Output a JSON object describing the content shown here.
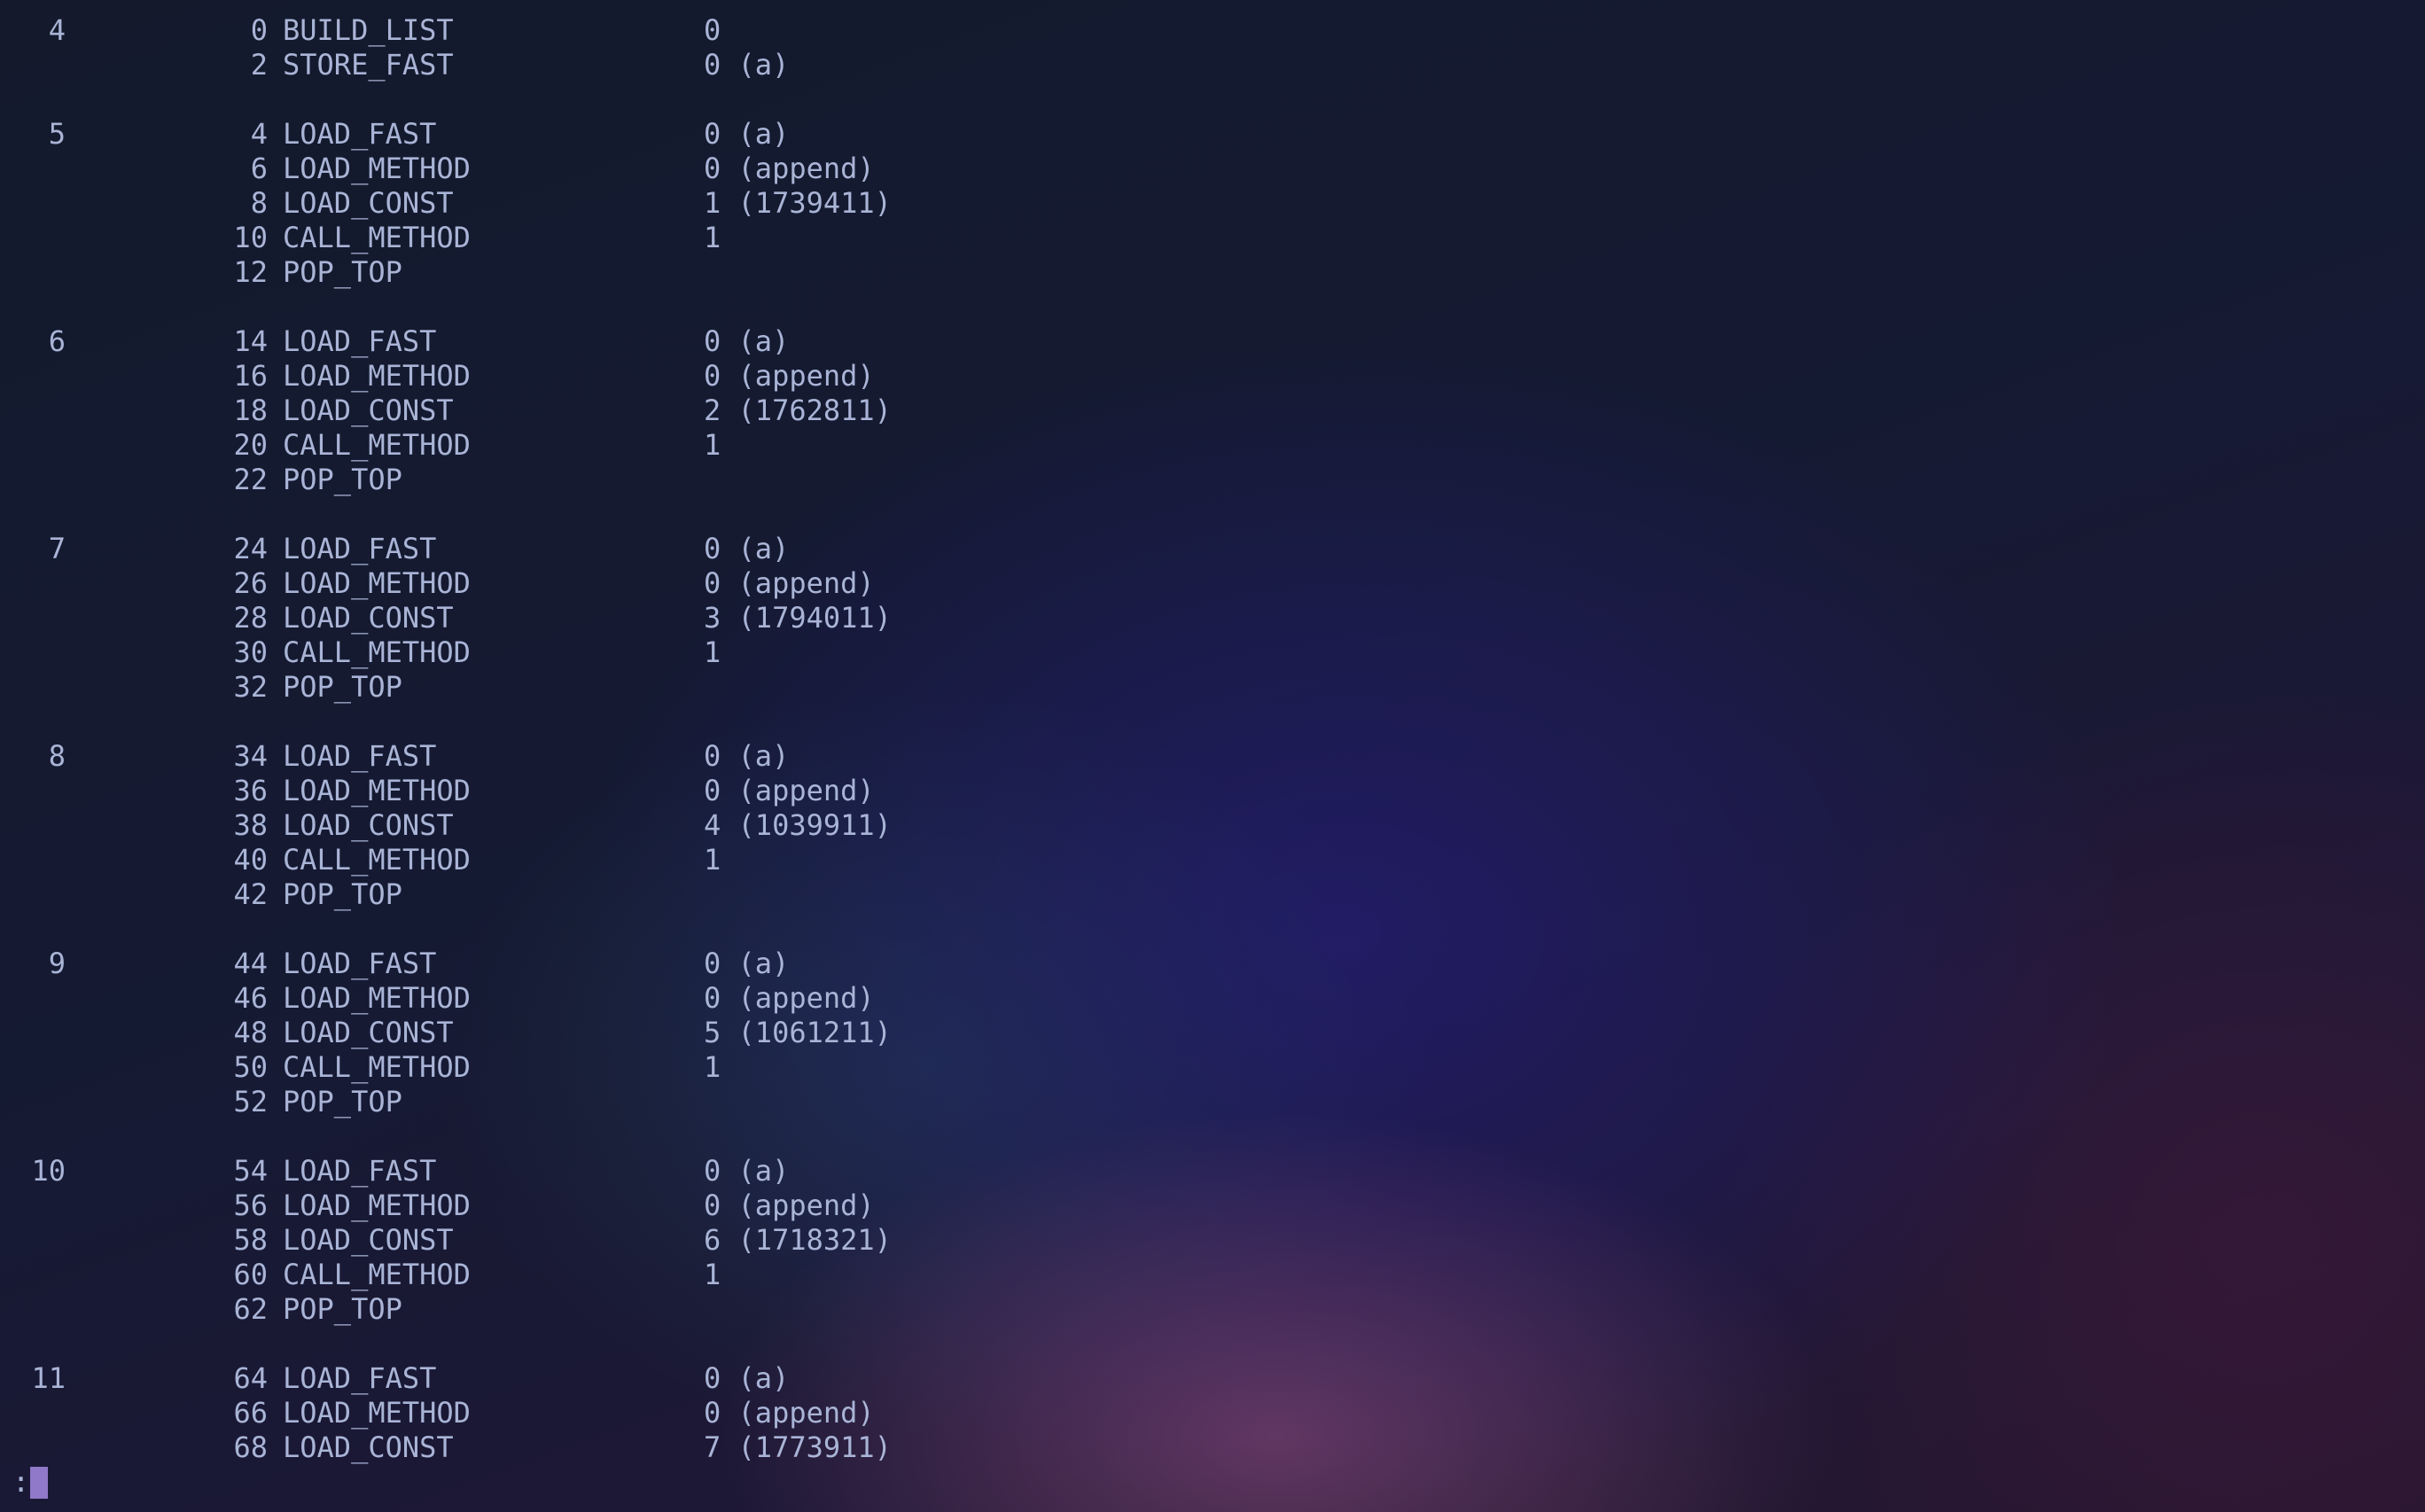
{
  "terminal": {
    "prompt_char": ":",
    "blocks": [
      {
        "lineno": "4",
        "instructions": [
          {
            "offset": "0",
            "op": "BUILD_LIST",
            "arg": "0"
          },
          {
            "offset": "2",
            "op": "STORE_FAST",
            "arg": "0 (a)"
          }
        ]
      },
      {
        "lineno": "5",
        "instructions": [
          {
            "offset": "4",
            "op": "LOAD_FAST",
            "arg": "0 (a)"
          },
          {
            "offset": "6",
            "op": "LOAD_METHOD",
            "arg": "0 (append)"
          },
          {
            "offset": "8",
            "op": "LOAD_CONST",
            "arg": "1 (1739411)"
          },
          {
            "offset": "10",
            "op": "CALL_METHOD",
            "arg": "1"
          },
          {
            "offset": "12",
            "op": "POP_TOP",
            "arg": ""
          }
        ]
      },
      {
        "lineno": "6",
        "instructions": [
          {
            "offset": "14",
            "op": "LOAD_FAST",
            "arg": "0 (a)"
          },
          {
            "offset": "16",
            "op": "LOAD_METHOD",
            "arg": "0 (append)"
          },
          {
            "offset": "18",
            "op": "LOAD_CONST",
            "arg": "2 (1762811)"
          },
          {
            "offset": "20",
            "op": "CALL_METHOD",
            "arg": "1"
          },
          {
            "offset": "22",
            "op": "POP_TOP",
            "arg": ""
          }
        ]
      },
      {
        "lineno": "7",
        "instructions": [
          {
            "offset": "24",
            "op": "LOAD_FAST",
            "arg": "0 (a)"
          },
          {
            "offset": "26",
            "op": "LOAD_METHOD",
            "arg": "0 (append)"
          },
          {
            "offset": "28",
            "op": "LOAD_CONST",
            "arg": "3 (1794011)"
          },
          {
            "offset": "30",
            "op": "CALL_METHOD",
            "arg": "1"
          },
          {
            "offset": "32",
            "op": "POP_TOP",
            "arg": ""
          }
        ]
      },
      {
        "lineno": "8",
        "instructions": [
          {
            "offset": "34",
            "op": "LOAD_FAST",
            "arg": "0 (a)"
          },
          {
            "offset": "36",
            "op": "LOAD_METHOD",
            "arg": "0 (append)"
          },
          {
            "offset": "38",
            "op": "LOAD_CONST",
            "arg": "4 (1039911)"
          },
          {
            "offset": "40",
            "op": "CALL_METHOD",
            "arg": "1"
          },
          {
            "offset": "42",
            "op": "POP_TOP",
            "arg": ""
          }
        ]
      },
      {
        "lineno": "9",
        "instructions": [
          {
            "offset": "44",
            "op": "LOAD_FAST",
            "arg": "0 (a)"
          },
          {
            "offset": "46",
            "op": "LOAD_METHOD",
            "arg": "0 (append)"
          },
          {
            "offset": "48",
            "op": "LOAD_CONST",
            "arg": "5 (1061211)"
          },
          {
            "offset": "50",
            "op": "CALL_METHOD",
            "arg": "1"
          },
          {
            "offset": "52",
            "op": "POP_TOP",
            "arg": ""
          }
        ]
      },
      {
        "lineno": "10",
        "instructions": [
          {
            "offset": "54",
            "op": "LOAD_FAST",
            "arg": "0 (a)"
          },
          {
            "offset": "56",
            "op": "LOAD_METHOD",
            "arg": "0 (append)"
          },
          {
            "offset": "58",
            "op": "LOAD_CONST",
            "arg": "6 (1718321)"
          },
          {
            "offset": "60",
            "op": "CALL_METHOD",
            "arg": "1"
          },
          {
            "offset": "62",
            "op": "POP_TOP",
            "arg": ""
          }
        ]
      },
      {
        "lineno": "11",
        "instructions": [
          {
            "offset": "64",
            "op": "LOAD_FAST",
            "arg": "0 (a)"
          },
          {
            "offset": "66",
            "op": "LOAD_METHOD",
            "arg": "0 (append)"
          },
          {
            "offset": "68",
            "op": "LOAD_CONST",
            "arg": "7 (1773911)"
          }
        ]
      }
    ]
  }
}
